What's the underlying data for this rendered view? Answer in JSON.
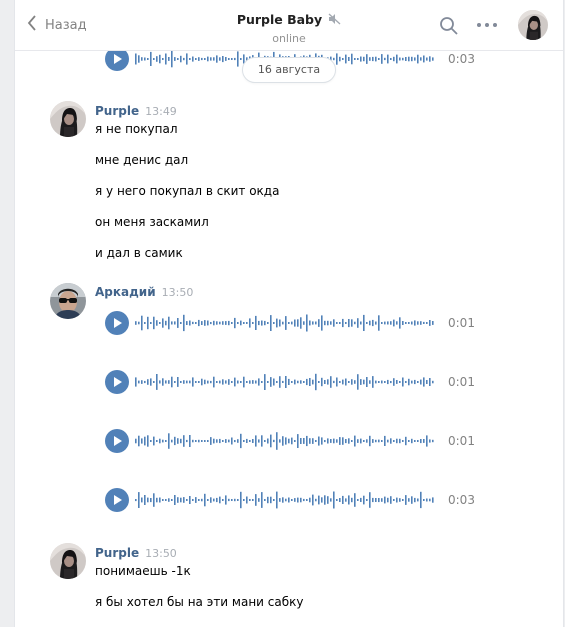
{
  "header": {
    "back_label": "Назад",
    "title": "Purple Baby",
    "subtitle": "online"
  },
  "date_separator": "16 августа",
  "top_audio": {
    "duration": "0:03"
  },
  "messages": [
    {
      "author": "Purple",
      "time": "13:49",
      "lines": [
        "я не покупал",
        "мне денис дал",
        "я у него покупал в скит окда",
        "он меня заскамил",
        "и дал в самик"
      ]
    },
    {
      "author": "Аркадий",
      "time": "13:50",
      "audios": [
        {
          "duration": "0:01"
        },
        {
          "duration": "0:01"
        },
        {
          "duration": "0:01"
        },
        {
          "duration": "0:03"
        }
      ]
    },
    {
      "author": "Purple",
      "time": "13:50",
      "lines": [
        "понимаешь -1к",
        "я бы хотел бы на эти мани сабку"
      ]
    }
  ],
  "icons": {
    "back": "chevron-left-icon",
    "muted": "speaker-muted-icon",
    "search": "search-icon",
    "more": "more-dots-icon",
    "play": "play-icon"
  },
  "colors": {
    "accent": "#5181b8",
    "author": "#42648b",
    "waveform": "#5181b8",
    "muted_text": "#828282",
    "background": "#edeef0"
  }
}
